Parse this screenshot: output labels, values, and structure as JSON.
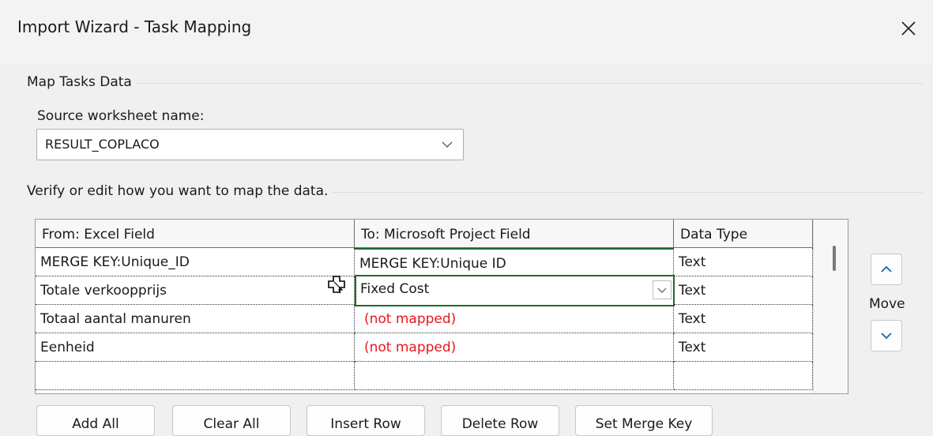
{
  "window": {
    "title": "Import Wizard - Task Mapping"
  },
  "map_group": {
    "label": "Map Tasks Data",
    "source_label": "Source worksheet name:",
    "source_value": "RESULT_COPLACO"
  },
  "verify_group": {
    "label": "Verify or edit how you want to map the data."
  },
  "grid": {
    "headers": [
      "From: Excel Field",
      "To:  Microsoft Project Field",
      "Data Type"
    ],
    "rows": [
      {
        "from": "MERGE KEY:Unique_ID",
        "to": "MERGE KEY:Unique ID",
        "type": "Text"
      },
      {
        "from": "Totale verkoopprijs",
        "to": "Fixed Cost",
        "type": "Text"
      },
      {
        "from": "Totaal aantal manuren",
        "to": "(not mapped)",
        "type": "Text"
      },
      {
        "from": "Eenheid",
        "to": "(not mapped)",
        "type": "Text"
      },
      {
        "from": "",
        "to": "",
        "type": ""
      }
    ]
  },
  "move": {
    "label": "Move"
  },
  "buttons": {
    "add_all": "Add All",
    "clear_all": "Clear All",
    "insert_row": "Insert Row",
    "delete_row": "Delete Row",
    "set_merge_key": "Set Merge Key"
  },
  "colors": {
    "not_mapped": "#e8161e",
    "active_border": "#1f6b2a",
    "dialog_bg": "#f0f0f0",
    "move_arrow": "#1f5fa8"
  },
  "icons": {
    "close": "close-icon",
    "combo_arrow": "chevron-down-icon",
    "move_up": "chevron-up-icon",
    "move_down": "chevron-down-icon",
    "cursor": "move-cursor-icon"
  }
}
